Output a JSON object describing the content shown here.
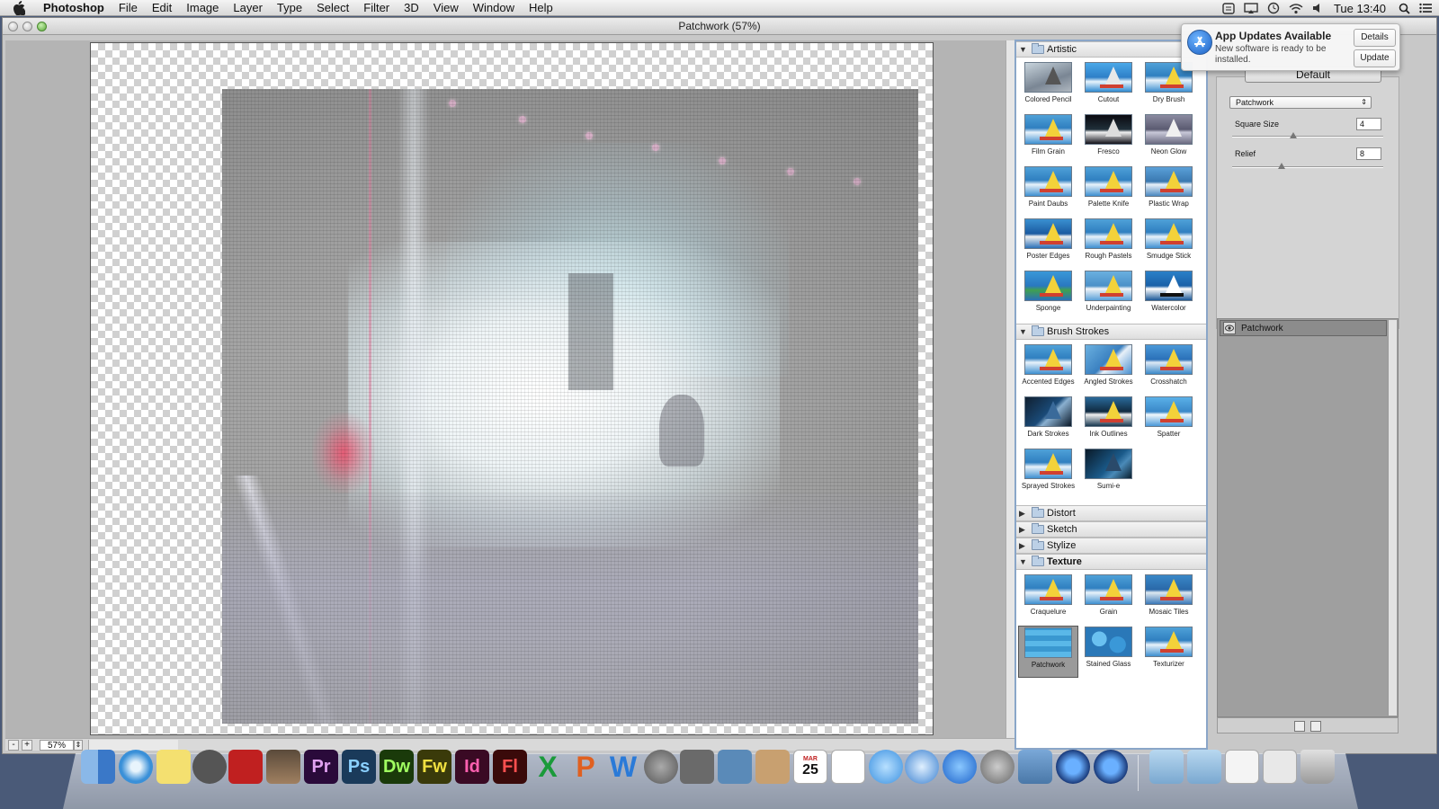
{
  "menubar": {
    "app": "Photoshop",
    "items": [
      "File",
      "Edit",
      "Image",
      "Layer",
      "Type",
      "Select",
      "Filter",
      "3D",
      "View",
      "Window",
      "Help"
    ],
    "clock": "Tue 13:40"
  },
  "window": {
    "title": "Patchwork (57%)"
  },
  "status": {
    "zoom": "57%"
  },
  "gallery": {
    "categories": {
      "artistic": {
        "name": "Artistic",
        "items": [
          "Colored Pencil",
          "Cutout",
          "Dry Brush",
          "Film Grain",
          "Fresco",
          "Neon Glow",
          "Paint Daubs",
          "Palette Knife",
          "Plastic Wrap",
          "Poster Edges",
          "Rough Pastels",
          "Smudge Stick",
          "Sponge",
          "Underpainting",
          "Watercolor"
        ]
      },
      "brush_strokes": {
        "name": "Brush Strokes",
        "items": [
          "Accented Edges",
          "Angled Strokes",
          "Crosshatch",
          "Dark Strokes",
          "Ink Outlines",
          "Spatter",
          "Sprayed Strokes",
          "Sumi-e"
        ]
      },
      "distort": {
        "name": "Distort"
      },
      "sketch": {
        "name": "Sketch"
      },
      "stylize": {
        "name": "Stylize"
      },
      "texture": {
        "name": "Texture",
        "items": [
          "Craquelure",
          "Grain",
          "Mosaic Tiles",
          "Patchwork",
          "Stained Glass",
          "Texturizer"
        ],
        "selected": "Patchwork"
      }
    }
  },
  "settings": {
    "default_button": "Default",
    "filter_select": "Patchwork",
    "square_size_label": "Square Size",
    "square_size_value": "4",
    "relief_label": "Relief",
    "relief_value": "8"
  },
  "layers": {
    "row_label": "Patchwork"
  },
  "notification": {
    "title": "App Updates Available",
    "body": "New software is ready to be installed.",
    "details_button": "Details",
    "update_button": "Update"
  },
  "dock": {
    "apps": [
      "Finder",
      "Safari",
      "Stickies",
      "FaceTime",
      "Photo Booth",
      "iPhoto",
      "Premiere Pro",
      "Photoshop",
      "Dreamweaver",
      "Fireworks",
      "InDesign",
      "Flash",
      "Excel",
      "PowerPoint",
      "Word",
      "Launchpad",
      "Image Capture",
      "Preview",
      "Contacts",
      "Calendar",
      "Reminders",
      "Messages",
      "iTunes",
      "App Store",
      "System Preferences",
      "iPhoto Library",
      "QuickTime",
      "QuickTime X",
      "Applications",
      "Documents",
      "PDF",
      "Downloads",
      "Trash"
    ],
    "calendar_day": "25",
    "calendar_month": "MAR"
  },
  "colors": {
    "ps_blue": "#1a3a5a",
    "pr_purple": "#2a0a3a",
    "dw_green": "#1a3a0a",
    "fw_yellow": "#3a3a0a",
    "id_pink": "#3a0a24",
    "fl_red": "#3a0a0a"
  }
}
